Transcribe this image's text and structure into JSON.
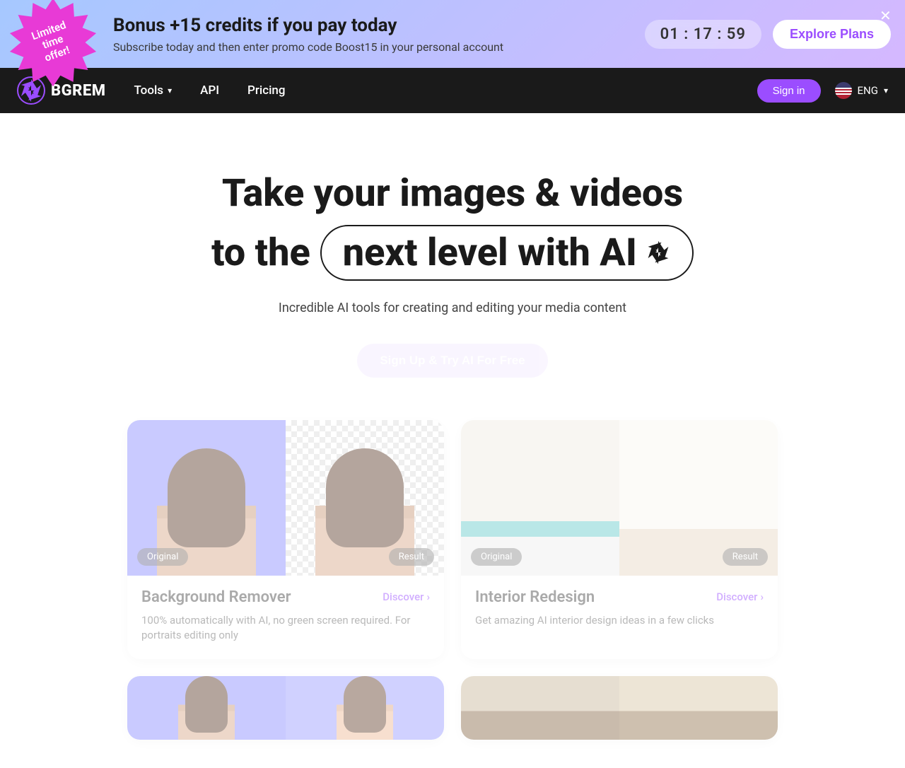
{
  "promo": {
    "burst": "Limited time offer!",
    "title": "Bonus +15 credits if you pay today",
    "subtitle": "Subscribe today and then enter promo code Boost15 in your personal account",
    "timer": "01 : 17 : 59",
    "cta": "Explore Plans"
  },
  "nav": {
    "brand": "BGREM",
    "links": {
      "tools": "Tools",
      "api": "API",
      "pricing": "Pricing"
    },
    "signin": "Sign in",
    "lang": "ENG"
  },
  "hero": {
    "line1": "Take your images & videos",
    "line2_prefix": "to the",
    "pill_text": "next level with AI",
    "subtitle": "Incredible AI tools for creating and editing your media content",
    "cta": "Sign Up & Try AI For Free"
  },
  "cards": [
    {
      "title": "Background Remover",
      "desc": "100% automatically with AI, no green screen required. For portraits editing only",
      "discover": "Discover",
      "badge_original": "Original",
      "badge_result": "Result"
    },
    {
      "title": "Interior Redesign",
      "desc": "Get amazing AI interior design ideas in a few clicks",
      "discover": "Discover",
      "badge_original": "Original",
      "badge_result": "Result"
    }
  ],
  "colors": {
    "accent": "#9b4dff",
    "burst": "#e83ad6",
    "nav_bg": "#1a1a1a"
  }
}
